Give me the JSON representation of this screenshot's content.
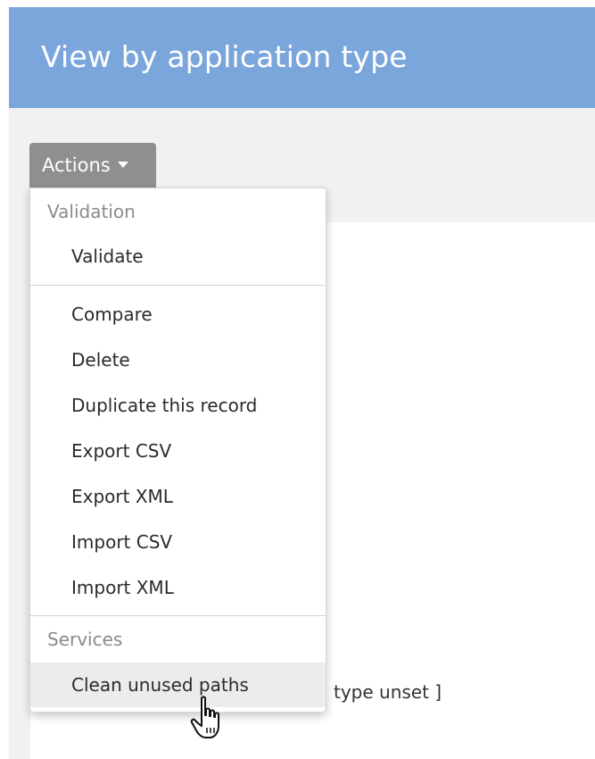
{
  "header": {
    "title": "View by application type"
  },
  "actions": {
    "label": "Actions"
  },
  "menu": {
    "validation_header": "Validation",
    "validate": "Validate",
    "items": [
      "Compare",
      "Delete",
      "Duplicate this record",
      "Export CSV",
      "Export XML",
      "Import CSV",
      "Import XML"
    ],
    "services_header": "Services",
    "clean_unused_paths": "Clean unused paths"
  },
  "background": {
    "partial_text": "type unset ]"
  },
  "colors": {
    "header_bg": "#7aa6dc",
    "button_bg": "#8f8f8f",
    "hover_bg": "#ececec"
  },
  "icons": {
    "caret": "caret-down-icon",
    "cursor": "hand-pointer-cursor-icon"
  }
}
